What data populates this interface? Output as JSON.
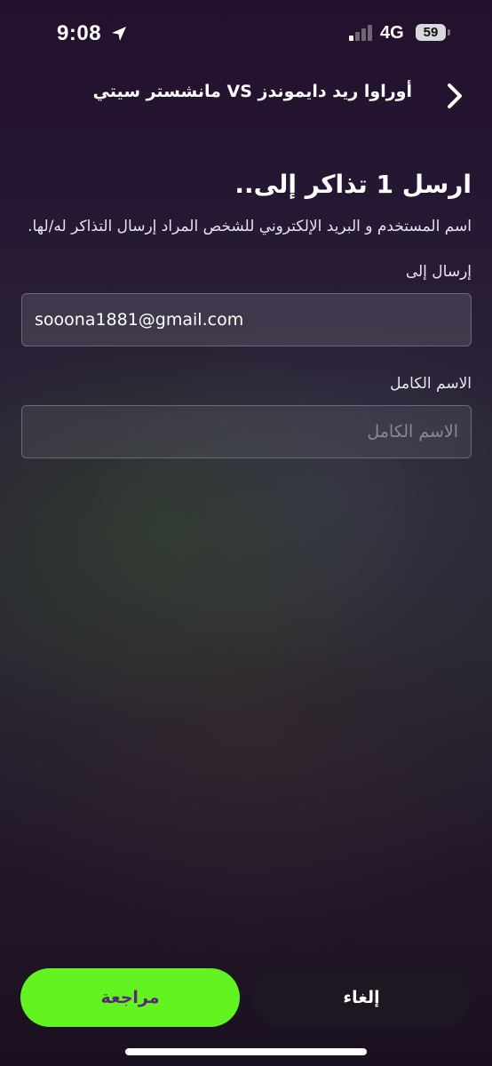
{
  "status_bar": {
    "time": "9:08",
    "network": "4G",
    "battery": "59"
  },
  "header": {
    "title": "أوراوا ريد دايموندز VS مانشستر سيتي"
  },
  "form": {
    "heading": "ارسل 1 تذاكر إلى..",
    "description": "اسم المستخدم و البريد الإلكتروني للشخص المراد إرسال التذاكر له/لها.",
    "send_to_label": "إرسال إلى",
    "email_value": "sooona1881@gmail.com",
    "full_name_label": "الاسم الكامل",
    "full_name_placeholder": "الاسم الكامل",
    "full_name_value": ""
  },
  "actions": {
    "review_label": "مراجعة",
    "cancel_label": "إلغاء"
  },
  "colors": {
    "accent_green": "#62f321",
    "review_text": "#5b2677",
    "cancel_bg": "#1d1721"
  }
}
